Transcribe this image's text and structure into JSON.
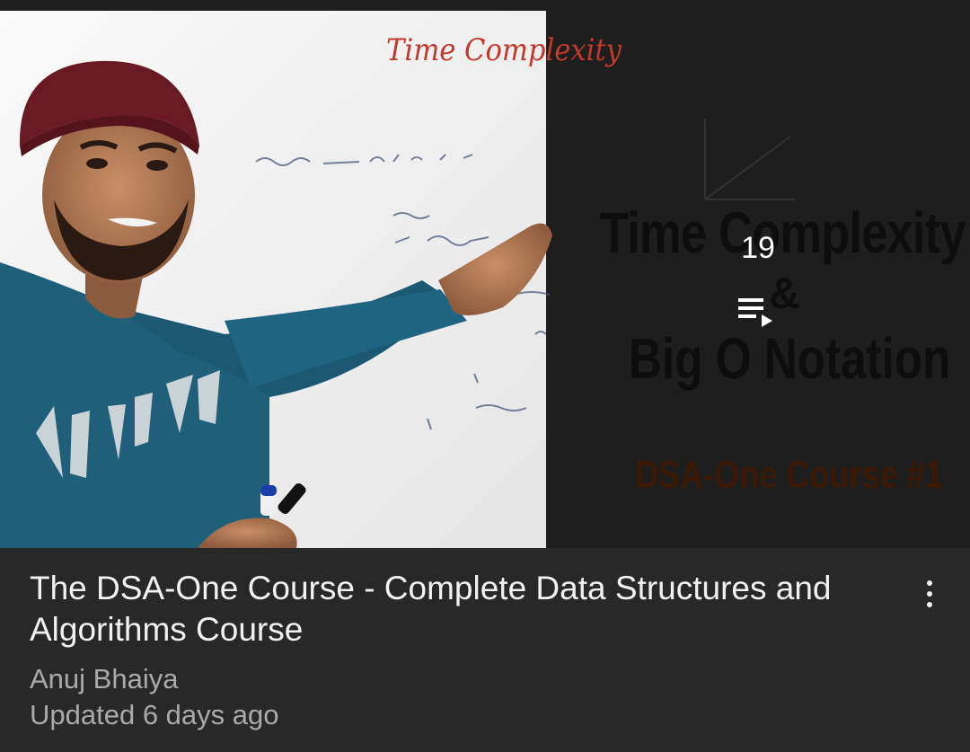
{
  "thumbnail": {
    "handwritten_title": "Time Complexity",
    "overlay_title": "Time Complexity",
    "overlay_amp": "&",
    "overlay_subtitle": "Big O Notation",
    "overlay_course": "DSA-One Course #1"
  },
  "playlist": {
    "video_count": "19",
    "icon": "playlist-play-icon"
  },
  "video": {
    "title": "The DSA-One Course - Complete Data Structures and Algorithms Course",
    "channel": "Anuj Bhaiya",
    "updated": "Updated 6 days ago"
  },
  "actions": {
    "more_icon": "more-vert-icon"
  },
  "colors": {
    "background": "#282828",
    "title_text": "#f1f1f1",
    "meta_text": "#aaaaaa",
    "overlay_dark": "#1e1e1e"
  }
}
